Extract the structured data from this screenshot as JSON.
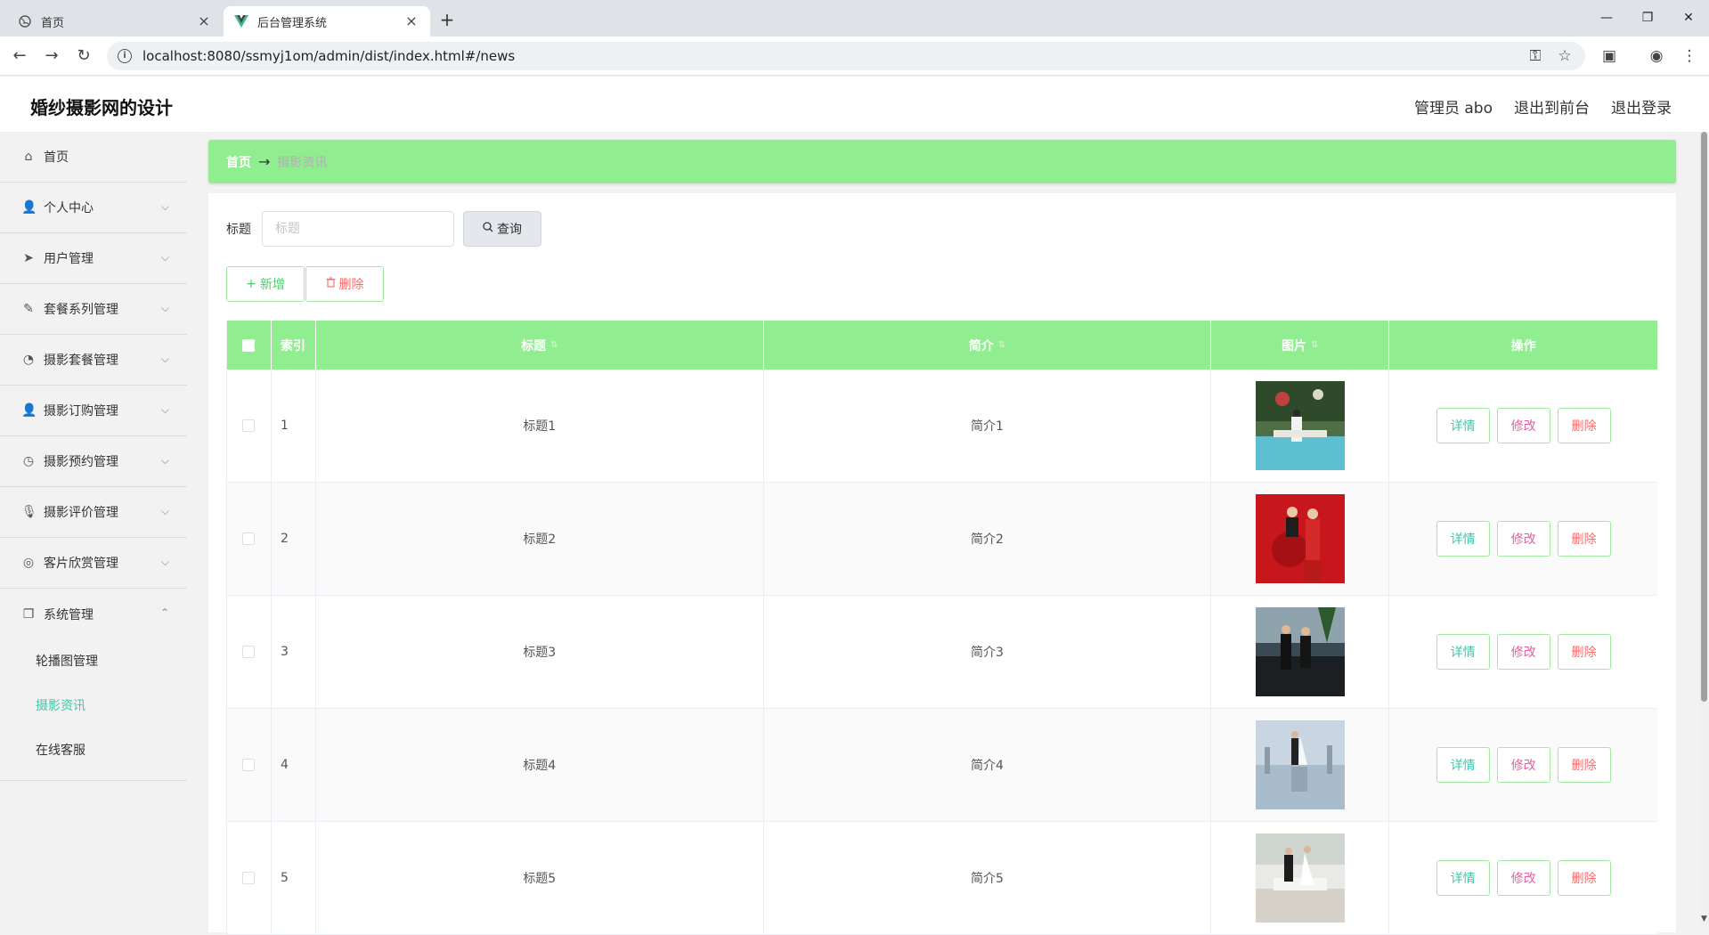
{
  "browser": {
    "tabs": [
      {
        "label": "首页",
        "icon": "globe-icon"
      },
      {
        "label": "后台管理系统",
        "icon": "vue-icon"
      }
    ],
    "url": "localhost:8080/ssmyj1om/admin/dist/index.html#/news"
  },
  "header": {
    "title": "婚纱摄影网的设计",
    "links": [
      "管理员 abo",
      "退出到前台",
      "退出登录"
    ]
  },
  "sidebar": {
    "items": [
      {
        "label": "首页",
        "icon": "home-icon"
      },
      {
        "label": "个人中心",
        "icon": "user-icon"
      },
      {
        "label": "用户管理",
        "icon": "send-icon"
      },
      {
        "label": "套餐系列管理",
        "icon": "pen-icon"
      },
      {
        "label": "摄影套餐管理",
        "icon": "gauge-icon"
      },
      {
        "label": "摄影订购管理",
        "icon": "person-icon"
      },
      {
        "label": "摄影预约管理",
        "icon": "clock-icon"
      },
      {
        "label": "摄影评价管理",
        "icon": "mic-icon"
      },
      {
        "label": "客片欣赏管理",
        "icon": "target-icon"
      },
      {
        "label": "系统管理",
        "icon": "copy-icon"
      }
    ],
    "subitems": [
      "轮播图管理",
      "摄影资讯",
      "在线客服"
    ]
  },
  "breadcrumb": {
    "home": "首页",
    "current": "摄影资讯"
  },
  "search": {
    "label": "标题",
    "placeholder": "标题",
    "button": "查询"
  },
  "actions": {
    "add": "新增",
    "delete": "删除"
  },
  "table": {
    "columns": [
      "索引",
      "标题",
      "简介",
      "图片",
      "操作"
    ],
    "rows": [
      {
        "index": "1",
        "title": "标题1",
        "intro": "简介1"
      },
      {
        "index": "2",
        "title": "标题2",
        "intro": "简介2"
      },
      {
        "index": "3",
        "title": "标题3",
        "intro": "简介3"
      },
      {
        "index": "4",
        "title": "标题4",
        "intro": "简介4"
      },
      {
        "index": "5",
        "title": "标题5",
        "intro": "简介5"
      }
    ],
    "row_actions": {
      "detail": "详情",
      "edit": "修改",
      "remove": "删除"
    }
  },
  "colors": {
    "accent_green": "#90ee90",
    "active_teal": "#3cc8a8",
    "danger": "#f56c6c"
  }
}
